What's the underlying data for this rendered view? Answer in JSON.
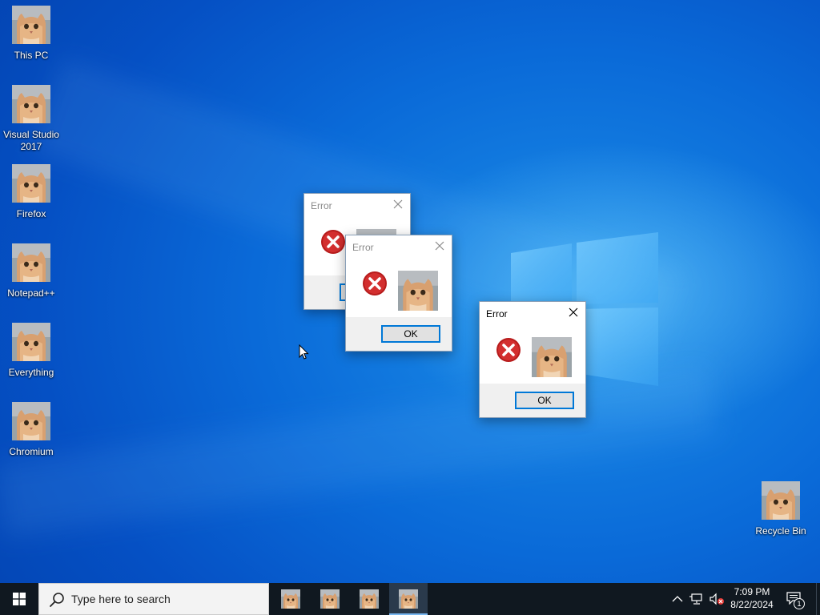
{
  "desktop": {
    "icons": [
      {
        "label_lines": [
          "This PC"
        ],
        "icon": "this-pc-icon"
      },
      {
        "label_lines": [
          "Visual Studio",
          "2017"
        ],
        "icon": "visual-studio-icon"
      },
      {
        "label_lines": [
          "Firefox"
        ],
        "icon": "firefox-icon"
      },
      {
        "label_lines": [
          "Notepad++"
        ],
        "icon": "notepad-plus-plus-icon"
      },
      {
        "label_lines": [
          "Everything"
        ],
        "icon": "everything-icon"
      },
      {
        "label_lines": [
          "Chromium"
        ],
        "icon": "chromium-icon"
      },
      {
        "label_lines": [
          "Recycle Bin"
        ],
        "icon": "recycle-bin-icon"
      }
    ]
  },
  "dialogs": [
    {
      "title": "Error",
      "ok_label": "OK",
      "active": false
    },
    {
      "title": "Error",
      "ok_label": "OK",
      "active": false
    },
    {
      "title": "Error",
      "ok_label": "OK",
      "active": true
    }
  ],
  "taskbar": {
    "search_placeholder": "Type here to search",
    "apps": [
      {
        "name": "cat-app-1",
        "active": false
      },
      {
        "name": "cat-app-2",
        "active": false
      },
      {
        "name": "cat-app-3",
        "active": false
      },
      {
        "name": "cat-app-4",
        "active": true
      }
    ],
    "clock": {
      "time": "7:09 PM",
      "date": "8/22/2024"
    },
    "notification_count": "1"
  },
  "colors": {
    "desktop_blue": "#0a6ad8",
    "taskbar": "#101820",
    "error_red": "#c62828",
    "focus_blue": "#0078d7"
  }
}
